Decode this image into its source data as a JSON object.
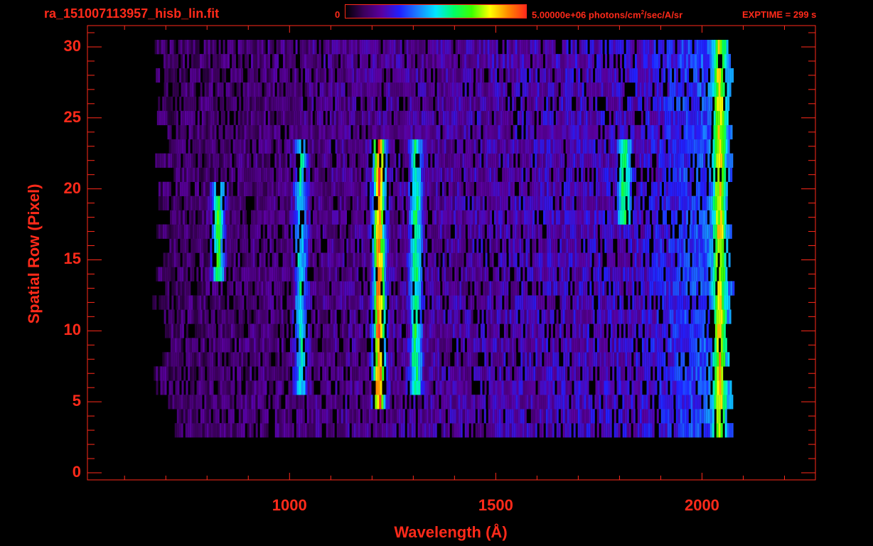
{
  "header": {
    "filename": "ra_151007113957_hisb_lin.fit",
    "colorbar_min": "0",
    "colorbar_max_prefix": "5.00000e+06 photons/cm",
    "colorbar_max_sup": "2",
    "colorbar_max_suffix": "/sec/A/sr",
    "exptime": "EXPTIME = 299 s"
  },
  "colors": {
    "axis": "#ff2a1a",
    "background": "#000000",
    "colormap": [
      "#000000",
      "#3b005a",
      "#5a00a0",
      "#2020ff",
      "#1a7fff",
      "#00e5ff",
      "#00ff66",
      "#3cff00",
      "#ffff00",
      "#ff8a00",
      "#ff2a1a"
    ]
  },
  "chart_data": {
    "type": "heatmap",
    "title": "ra_151007113957_hisb_lin.fit",
    "xlabel": "Wavelength (Å)",
    "ylabel": "Spatial Row (Pixel)",
    "xlim": [
      510,
      2275
    ],
    "ylim": [
      -0.5,
      31.5
    ],
    "xticks": [
      1000,
      1500,
      2000
    ],
    "yticks": [
      0,
      5,
      10,
      15,
      20,
      25,
      30
    ],
    "x_data_range": [
      680,
      2065
    ],
    "rows_with_signal": [
      3,
      30
    ],
    "colorbar_range": [
      0,
      5000000
    ],
    "colorbar_units": "photons/cm^2/sec/A/sr",
    "features": [
      {
        "center": 1215,
        "rows": [
          5,
          23
        ],
        "peak_level": 0.82
      },
      {
        "center": 1304,
        "rows": [
          6,
          23
        ],
        "peak_level": 0.45
      },
      {
        "center": 1025,
        "rows": [
          6,
          23
        ],
        "peak_level": 0.4
      },
      {
        "center": 825,
        "rows": [
          14,
          20
        ],
        "peak_level": 0.55
      },
      {
        "center": 1810,
        "rows": [
          18,
          23
        ],
        "peak_level": 0.42
      },
      {
        "center": 2040,
        "rows": [
          3,
          30
        ],
        "peak_level": 0.5
      }
    ]
  }
}
